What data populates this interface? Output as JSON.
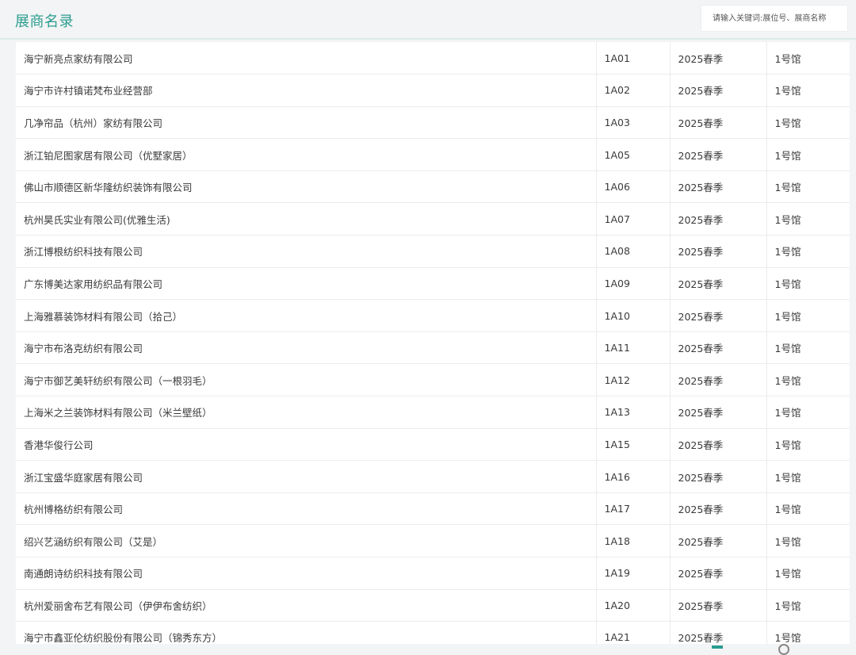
{
  "header": {
    "title": "展商名录",
    "search_placeholder": "请输入关键词:展位号、展商名称"
  },
  "exhibitors": [
    {
      "name": "海宁新亮点家纺有限公司",
      "booth": "1A01",
      "season": "2025春季",
      "hall": "1号馆"
    },
    {
      "name": "海宁市许村镇诺梵布业经营部",
      "booth": "1A02",
      "season": "2025春季",
      "hall": "1号馆"
    },
    {
      "name": "几净帘品（杭州）家纺有限公司",
      "booth": "1A03",
      "season": "2025春季",
      "hall": "1号馆"
    },
    {
      "name": "浙江铂尼图家居有限公司（优墅家居）",
      "booth": "1A05",
      "season": "2025春季",
      "hall": "1号馆"
    },
    {
      "name": "佛山市顺德区新华隆纺织装饰有限公司",
      "booth": "1A06",
      "season": "2025春季",
      "hall": "1号馆"
    },
    {
      "name": "杭州昊氏实业有限公司(优雅生活)",
      "booth": "1A07",
      "season": "2025春季",
      "hall": "1号馆"
    },
    {
      "name": "浙江博根纺织科技有限公司",
      "booth": "1A08",
      "season": "2025春季",
      "hall": "1号馆"
    },
    {
      "name": "广东博美达家用纺织品有限公司",
      "booth": "1A09",
      "season": "2025春季",
      "hall": "1号馆"
    },
    {
      "name": "上海雅慕装饰材料有限公司（拾己）",
      "booth": "1A10",
      "season": "2025春季",
      "hall": "1号馆"
    },
    {
      "name": "海宁市布洛克纺织有限公司",
      "booth": "1A11",
      "season": "2025春季",
      "hall": "1号馆"
    },
    {
      "name": "海宁市御艺美轩纺织有限公司（一根羽毛）",
      "booth": "1A12",
      "season": "2025春季",
      "hall": "1号馆"
    },
    {
      "name": "上海米之兰装饰材料有限公司（米兰壁纸）",
      "booth": "1A13",
      "season": "2025春季",
      "hall": "1号馆"
    },
    {
      "name": "香港华俊行公司",
      "booth": "1A15",
      "season": "2025春季",
      "hall": "1号馆"
    },
    {
      "name": "浙江宝盛华庭家居有限公司",
      "booth": "1A16",
      "season": "2025春季",
      "hall": "1号馆"
    },
    {
      "name": "杭州博格纺织有限公司",
      "booth": "1A17",
      "season": "2025春季",
      "hall": "1号馆"
    },
    {
      "name": "绍兴艺涵纺织有限公司（艾是）",
      "booth": "1A18",
      "season": "2025春季",
      "hall": "1号馆"
    },
    {
      "name": "南通朗诗纺织科技有限公司",
      "booth": "1A19",
      "season": "2025春季",
      "hall": "1号馆"
    },
    {
      "name": "杭州爱丽舍布艺有限公司（伊伊布舍纺织）",
      "booth": "1A20",
      "season": "2025春季",
      "hall": "1号馆"
    },
    {
      "name": "海宁市鑫亚伦纺织股份有限公司（锦秀东方）",
      "booth": "1A21",
      "season": "2025春季",
      "hall": "1号馆"
    }
  ]
}
